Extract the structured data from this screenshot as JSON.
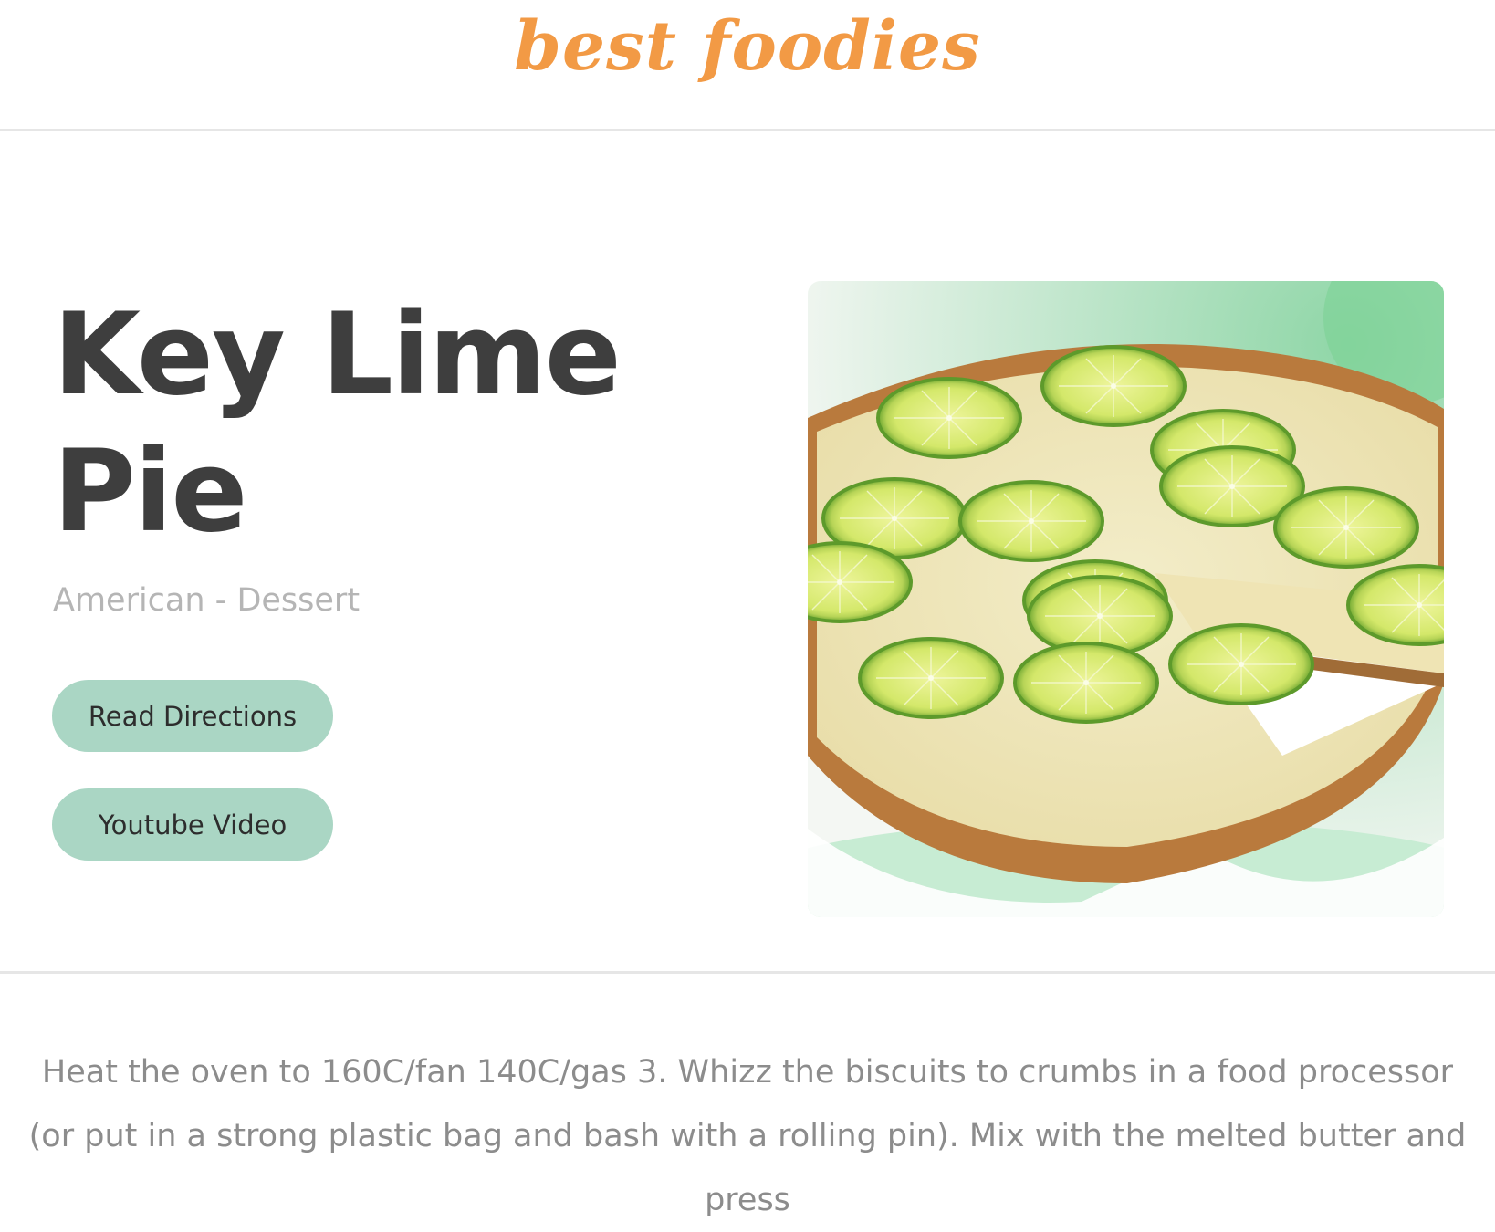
{
  "header": {
    "logo_text": "best foodies"
  },
  "recipe": {
    "title": "Key Lime Pie",
    "category_line": "American - Dessert",
    "buttons": {
      "read_directions": "Read Directions",
      "youtube_video": "Youtube Video"
    },
    "image_subject": "key-lime-pie-photo",
    "instructions": "Heat the oven to 160C/fan 140C/gas 3. Whizz the biscuits to crumbs in a food processor (or put in a strong plastic bag and bash with a rolling pin). Mix with the melted butter and press"
  },
  "colors": {
    "logo": "#f29a45",
    "button_bg": "#aad6c4",
    "title": "#3e3e3e",
    "subtitle": "#b5b5b5",
    "body_text": "#8c8c8c",
    "divider": "#e6e6e6"
  }
}
